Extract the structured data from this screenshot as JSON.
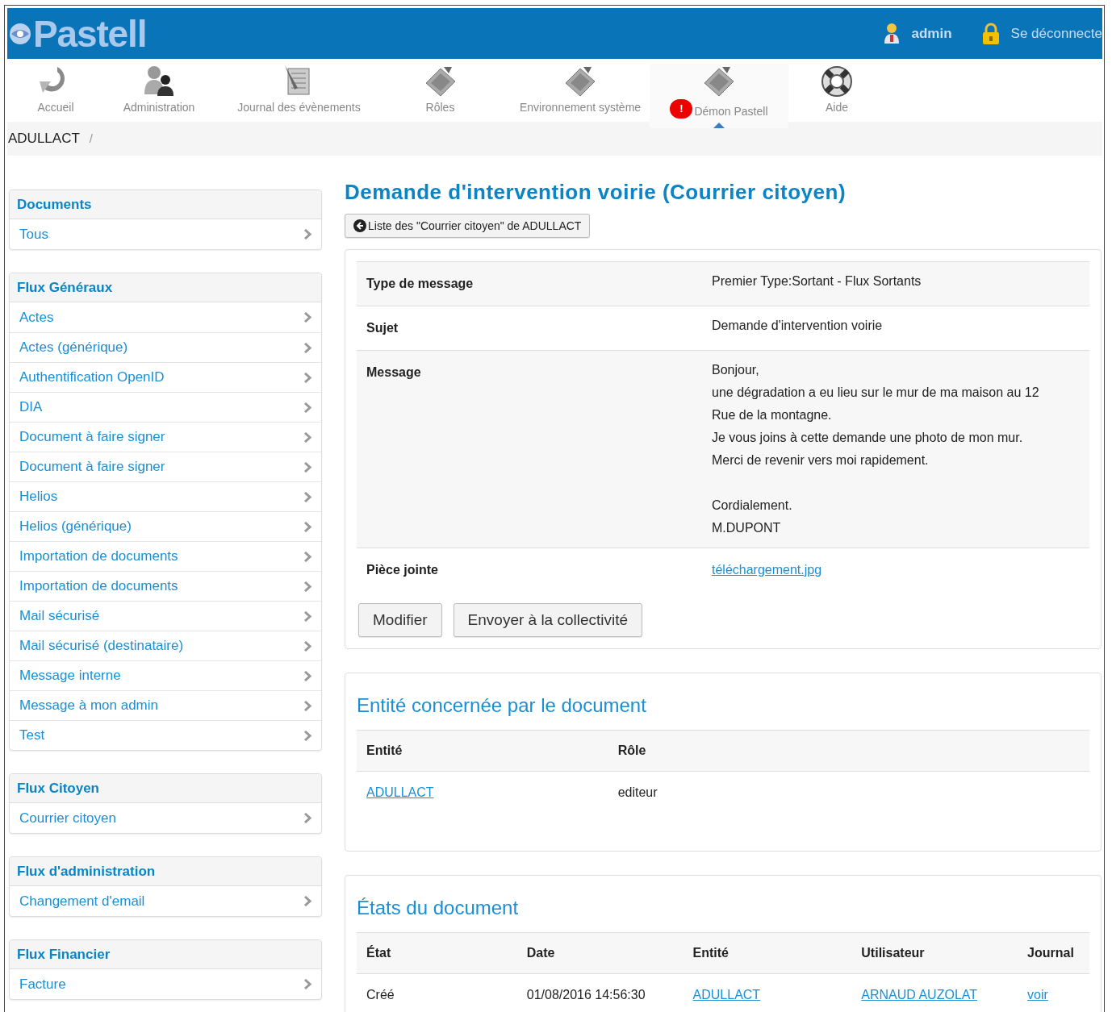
{
  "header": {
    "logo": "Pastell",
    "user": "admin",
    "logout": "Se déconnecte"
  },
  "nav": [
    {
      "label": "Accueil",
      "selected": false
    },
    {
      "label": "Administration",
      "selected": false
    },
    {
      "label": "Journal des évènements",
      "selected": false
    },
    {
      "label": "Rôles",
      "selected": false
    },
    {
      "label": "Environnement système",
      "selected": false
    },
    {
      "label": "Démon Pastell",
      "selected": true,
      "badge": "!"
    },
    {
      "label": "Aide",
      "selected": false
    }
  ],
  "breadcrumb": {
    "items": [
      "ADULLACT"
    ],
    "separator": "/"
  },
  "sidebar": [
    {
      "title": "Documents",
      "items": [
        "Tous"
      ]
    },
    {
      "title": "Flux Généraux",
      "items": [
        "Actes",
        "Actes (générique)",
        "Authentification OpenID",
        "DIA",
        "Document à faire signer",
        "Document à faire signer",
        "Helios",
        "Helios (générique)",
        "Importation de documents",
        "Importation de documents",
        "Mail sécurisé",
        "Mail sécurisé (destinataire)",
        "Message interne",
        "Message à mon admin",
        "Test"
      ]
    },
    {
      "title": "Flux Citoyen",
      "items": [
        "Courrier citoyen"
      ]
    },
    {
      "title": "Flux d'administration",
      "items": [
        "Changement d'email"
      ]
    },
    {
      "title": "Flux Financier",
      "items": [
        "Facture"
      ]
    }
  ],
  "page_title": "Demande d'intervention voirie (Courrier citoyen)",
  "back_button": "Liste des \"Courrier citoyen\" de ADULLACT",
  "details": [
    {
      "label": "Type de message",
      "value": "Premier Type:Sortant - Flux Sortants",
      "kind": "text"
    },
    {
      "label": "Sujet",
      "value": "Demande d'intervention voirie",
      "kind": "text"
    },
    {
      "label": "Message",
      "value": "Bonjour,\nune dégradation a eu lieu sur le mur de ma maison au 12 Rue de la montagne.\nJe vous joins à cette demande une photo de mon mur.\nMerci de revenir vers moi rapidement.\n\nCordialement.\nM.DUPONT",
      "kind": "text"
    },
    {
      "label": "Pièce jointe",
      "value": "téléchargement.jpg",
      "kind": "link"
    }
  ],
  "actions": [
    "Modifier",
    "Envoyer à la collectivité"
  ],
  "entity_section": {
    "title": "Entité concernée par le document",
    "columns": [
      "Entité",
      "Rôle"
    ],
    "rows": [
      [
        {
          "text": "ADULLACT",
          "kind": "link"
        },
        {
          "text": "editeur",
          "kind": "text"
        }
      ]
    ]
  },
  "states_section": {
    "title": "États du document",
    "columns": [
      "État",
      "Date",
      "Entité",
      "Utilisateur",
      "Journal"
    ],
    "rows": [
      [
        {
          "text": "Créé",
          "kind": "text"
        },
        {
          "text": "01/08/2016 14:56:30",
          "kind": "text"
        },
        {
          "text": "ADULLACT",
          "kind": "link"
        },
        {
          "text": "ARNAUD AUZOLAT",
          "kind": "link"
        },
        {
          "text": "voir",
          "kind": "link"
        }
      ]
    ]
  }
}
